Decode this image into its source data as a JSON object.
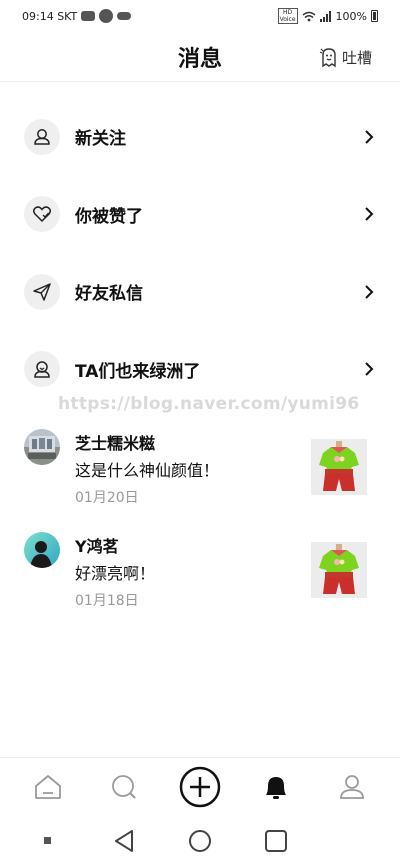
{
  "status_bar": {
    "time": "09:14 SKT",
    "battery": "100%"
  },
  "header": {
    "title": "消息",
    "feedback_label": "吐槽"
  },
  "menu": [
    {
      "label": "新关注",
      "icon": "follow-icon"
    },
    {
      "label": "你被赞了",
      "icon": "heart-icon"
    },
    {
      "label": "好友私信",
      "icon": "paper-plane-icon"
    },
    {
      "label": "TA们也来绿洲了",
      "icon": "oasis-icon"
    }
  ],
  "watermark": "https://blog.naver.com/yumi96",
  "messages": [
    {
      "name": "芝士糯米糍",
      "text": "这是什么神仙颜值！",
      "date": "01月20日"
    },
    {
      "name": "Y鸿茗",
      "text": "好漂亮啊！",
      "date": "01月18日"
    }
  ],
  "tabbar": [
    "home-icon",
    "discover-icon",
    "add-icon",
    "notification-icon",
    "profile-icon"
  ],
  "colors": {
    "text": "#111111",
    "muted": "#999999",
    "icon_bg": "#efefef",
    "watermark": "#d9d9d9"
  }
}
